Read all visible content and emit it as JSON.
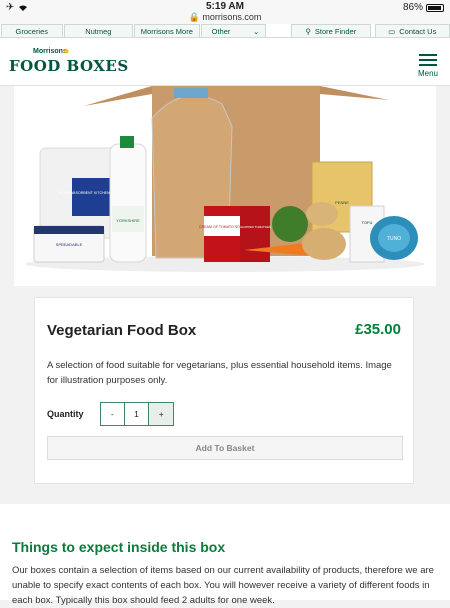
{
  "status_bar": {
    "time": "5:19 AM",
    "url": "morrisons.com",
    "battery": "86%"
  },
  "top_nav": {
    "tabs": [
      "Groceries",
      "Nutmeg",
      "Morrisons More",
      "Other",
      "Store Finder",
      "Contact Us"
    ]
  },
  "header": {
    "logo_small": "Morrisons",
    "logo_big": "FOOD BOXES",
    "menu_label": "Menu"
  },
  "product": {
    "title": "Vegetarian Food Box",
    "price": "£35.00",
    "description": "A selection of food suitable for vegetarians, plus essential household items. Image for illustration purposes only.",
    "quantity_label": "Quantity",
    "quantity_value": "1",
    "decrement": "-",
    "increment": "+",
    "add_button": "Add To Basket"
  },
  "hero_labels": {
    "towel": "ULTRA ABSORBENT KITCHEN TOWEL",
    "milk": "YORKSHIRE",
    "spread": "SPREADABLE",
    "soup": "CREAM OF TOMATO SOUP",
    "tomatoes": "CHOPPED TOMATOES",
    "pasta": "PENNE",
    "tofu": "TOFU",
    "tuno": "TUNO"
  },
  "info": {
    "heading": "Things to expect inside this box",
    "text": "Our boxes contain a selection of items based on our current availability of products, therefore we are unable to specify exact contents of each box. You will however receive a variety of different foods in each box. Typically this box should feed 2 adults for one week."
  },
  "colors": {
    "brand_green": "#00563f",
    "price_green": "#00803d"
  }
}
